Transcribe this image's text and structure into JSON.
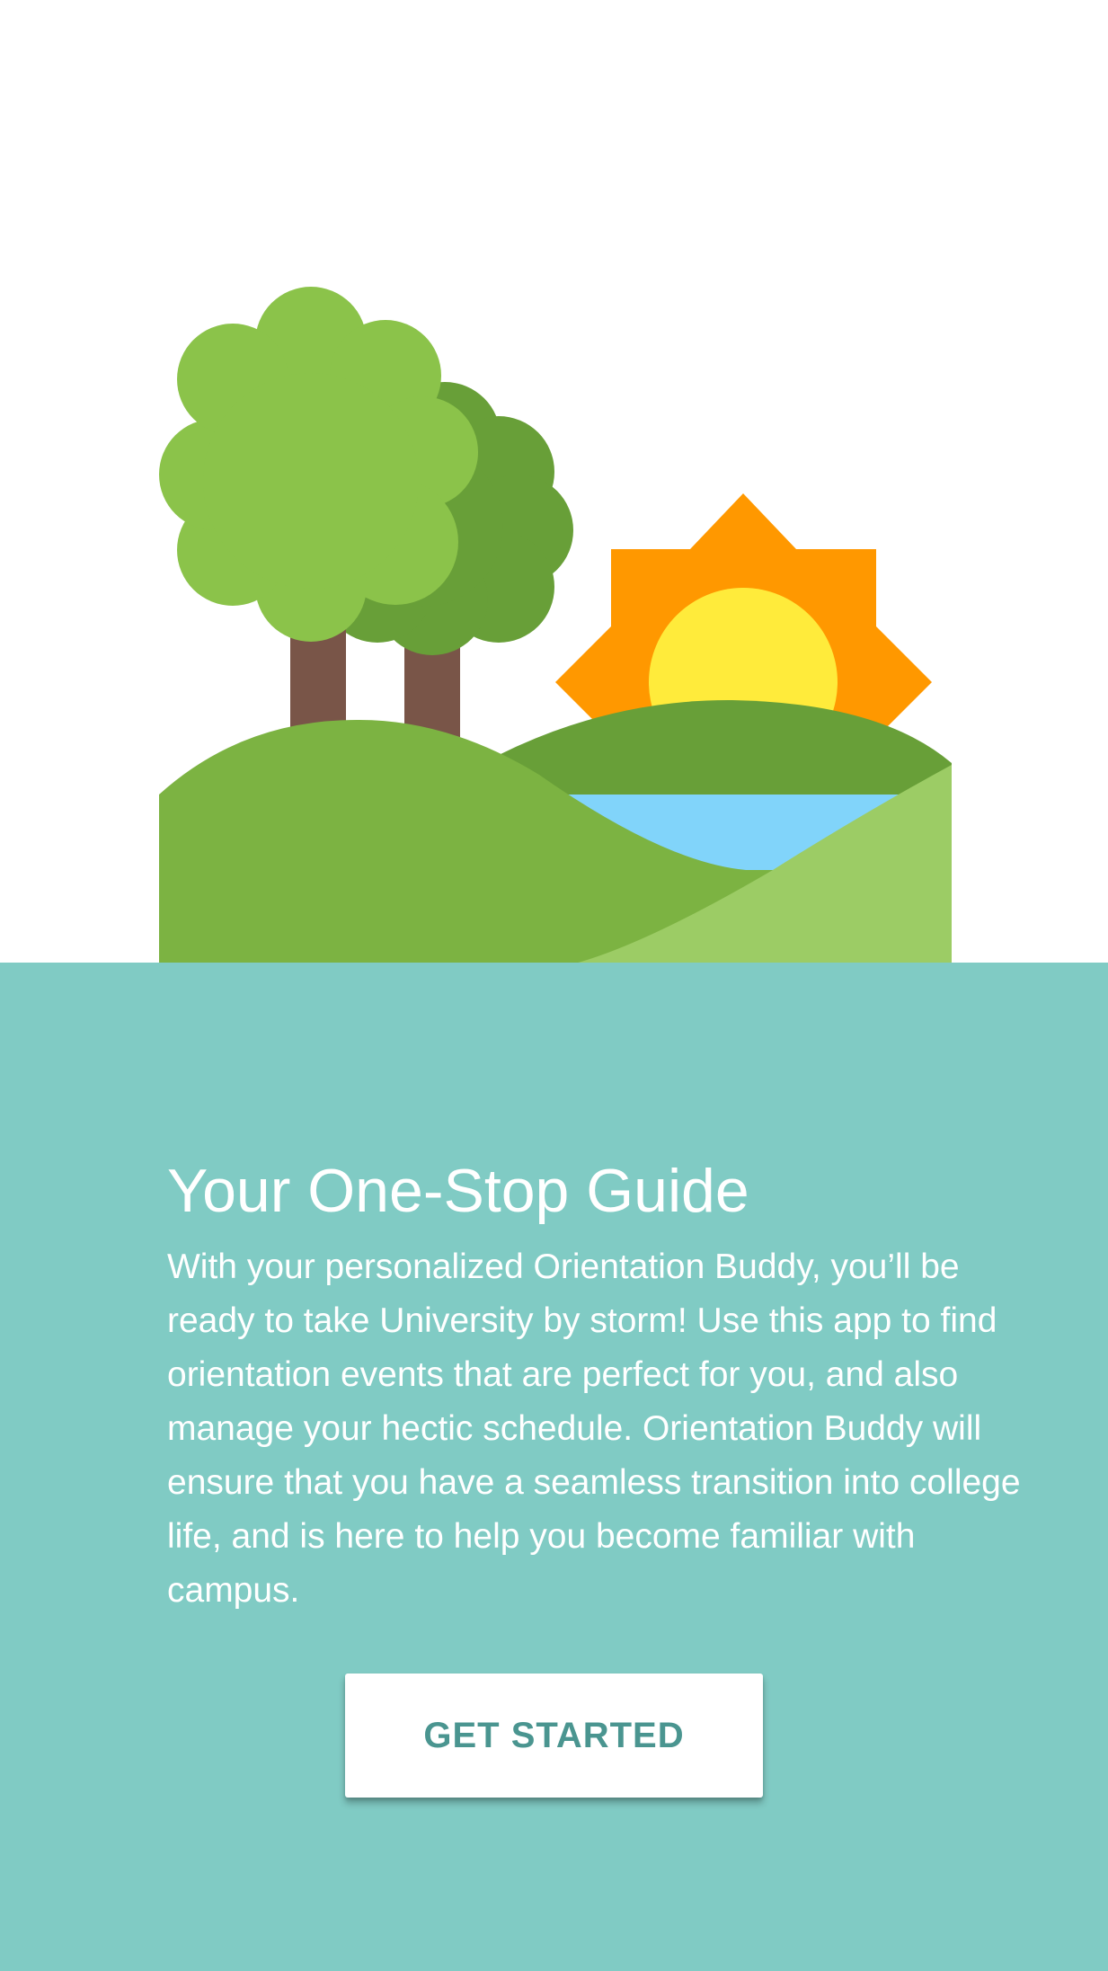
{
  "onboarding": {
    "title": "Your One-Stop Guide",
    "description": "With your personalized Orientation Buddy, you’ll be ready to take University by storm! Use this app to find orientation events that are perfect for you, and also manage your hectic schedule. Orientation Buddy will ensure that you have a seamless transition into college life, and is here to help you become familiar with campus.",
    "cta_label": "GET STARTED"
  },
  "colors": {
    "background": "#ffffff",
    "panel": "#80cbc4",
    "button_text": "#4a9590",
    "tree_light": "#8bc34a",
    "tree_dark": "#689f38",
    "trunk": "#795548",
    "sun_rays": "#ff9800",
    "sun_core": "#ffeb3b",
    "water": "#81d4fa",
    "hill_mid": "#7cb342",
    "hill_light": "#9ccc65"
  },
  "illustration": {
    "icon": "landscape-illustration",
    "elements": [
      "tree-icon",
      "tree-icon",
      "sun-icon",
      "lake-icon",
      "hill-icon"
    ]
  }
}
